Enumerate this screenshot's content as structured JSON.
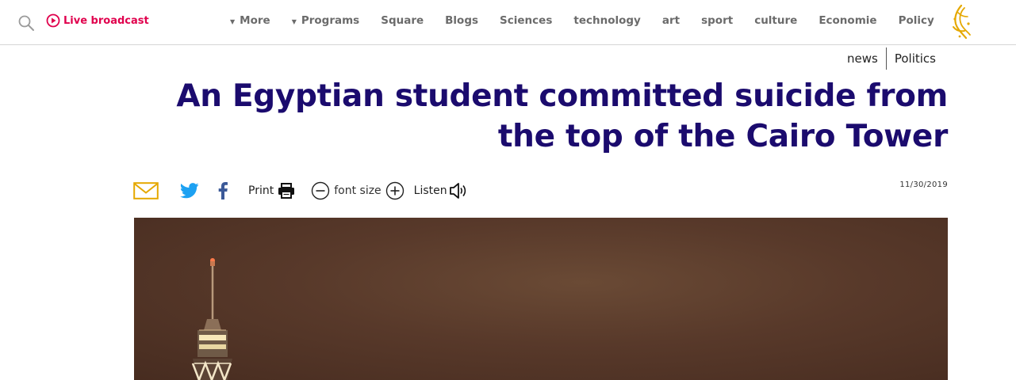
{
  "header": {
    "live_label": "Live broadcast",
    "nav": [
      {
        "label": "More",
        "dropdown": true
      },
      {
        "label": "Programs",
        "dropdown": true
      },
      {
        "label": "Square",
        "dropdown": false
      },
      {
        "label": "Blogs",
        "dropdown": false
      },
      {
        "label": "Sciences",
        "dropdown": false
      },
      {
        "label": "technology",
        "dropdown": false
      },
      {
        "label": "art",
        "dropdown": false
      },
      {
        "label": "sport",
        "dropdown": false
      },
      {
        "label": "culture",
        "dropdown": false
      },
      {
        "label": "Economie",
        "dropdown": false
      },
      {
        "label": "Policy",
        "dropdown": false
      }
    ],
    "logo_icon": "al-jazeera-logo-icon",
    "search_icon": "search-icon"
  },
  "breadcrumb": {
    "section": "news",
    "subsection": "Politics"
  },
  "article": {
    "title": "An Egyptian student committed suicide from the top of the Cairo Tower",
    "date": "11/30/2019"
  },
  "tools": {
    "print_label": "Print",
    "font_size_label": "font size",
    "listen_label": "Listen"
  },
  "colors": {
    "accent_live": "#e0004d",
    "title": "#1b0b6e",
    "nav_text": "#6b6b6b",
    "twitter": "#1da1f2",
    "facebook": "#3b5998",
    "mail": "#e5a800",
    "logo_gold": "#e5a800"
  }
}
